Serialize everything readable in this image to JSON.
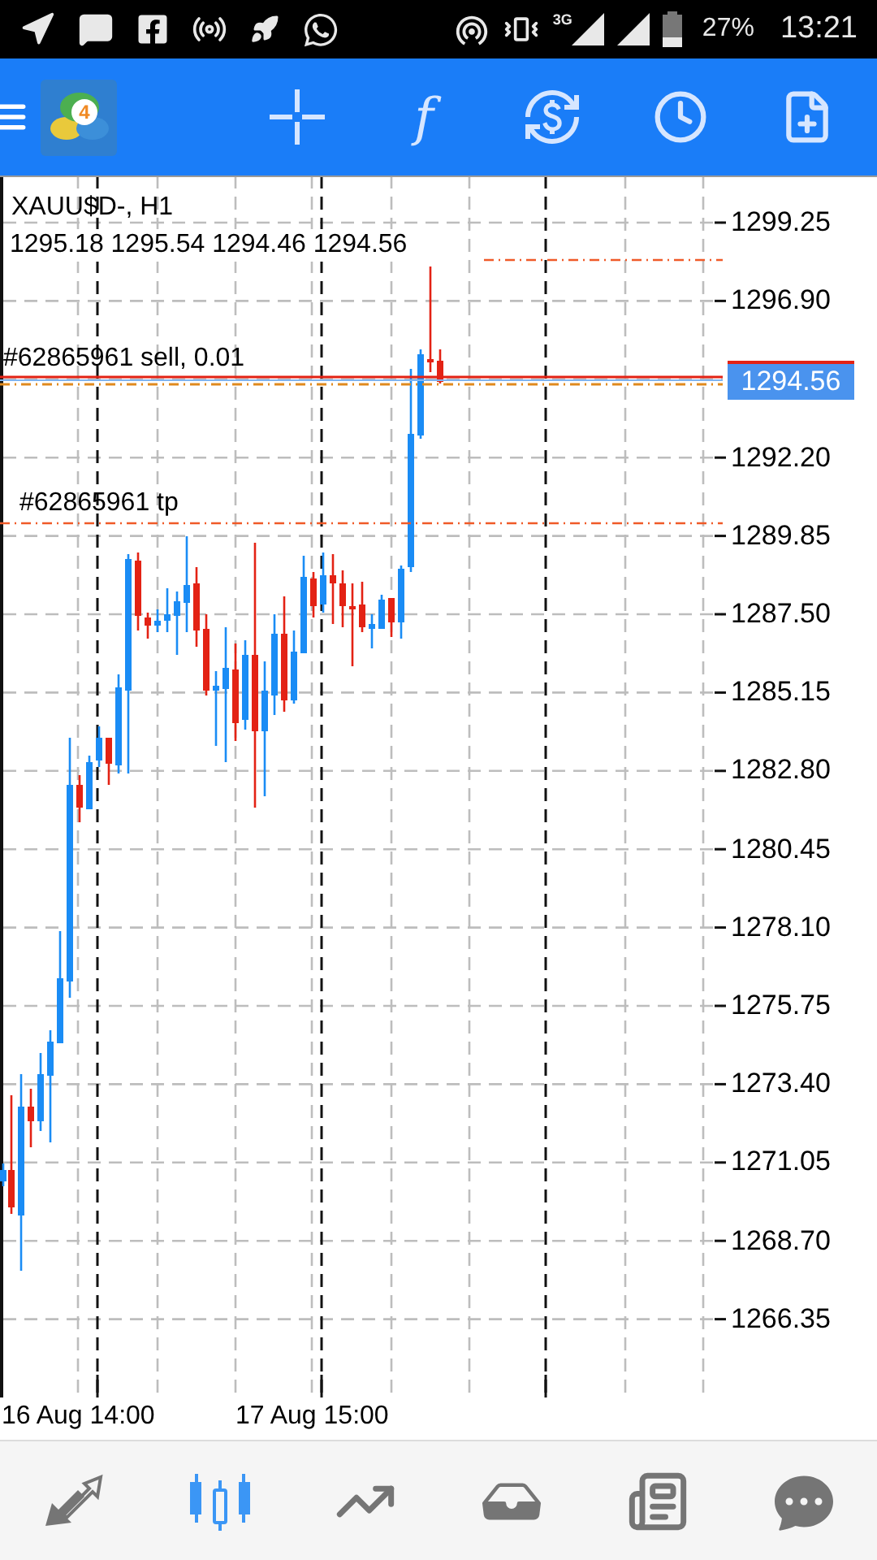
{
  "status_bar": {
    "network": "3G",
    "battery": "27%",
    "time": "13:21"
  },
  "toolbar": {
    "logo_badge": "4",
    "function_glyph": "f"
  },
  "chart": {
    "symbol": "XAUU$D-, H1",
    "ohlc": "1295.18 1295.54 1294.46 1294.56",
    "order_label": "#62865961 sell, 0.01",
    "tp_label": "#62865961 tp",
    "price_labels": [
      "1299.25",
      "1296.90",
      "1292.20",
      "1289.85",
      "1287.50",
      "1285.15",
      "1282.80",
      "1280.45",
      "1278.10",
      "1275.75",
      "1273.40",
      "1271.05",
      "1268.70",
      "1266.35"
    ],
    "current_price": "1294.56",
    "time_labels": [
      "16 Aug 14:00",
      "17 Aug 15:00"
    ]
  },
  "bottom_nav": [
    {
      "selected": false
    },
    {
      "selected": true
    },
    {
      "selected": false
    },
    {
      "selected": false
    },
    {
      "selected": false
    },
    {
      "selected": false
    }
  ]
}
